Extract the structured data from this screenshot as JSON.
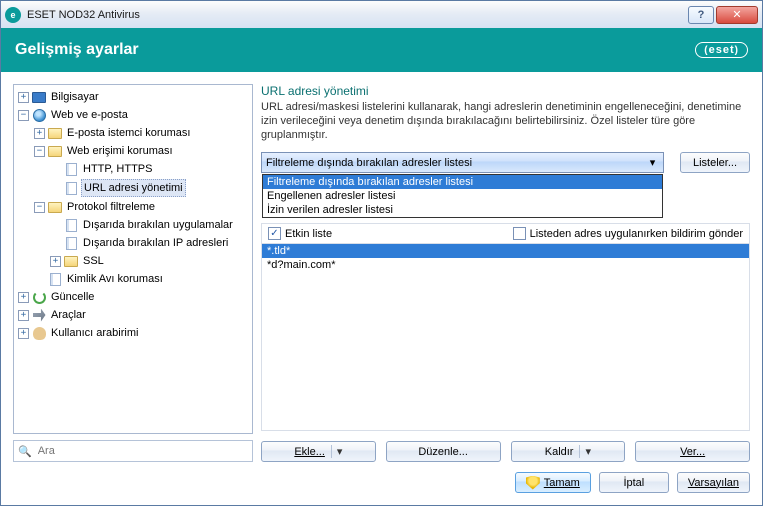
{
  "window": {
    "title": "ESET NOD32 Antivirus"
  },
  "header": {
    "title": "Gelişmiş ayarlar",
    "logo": "eset"
  },
  "tree": {
    "items": [
      {
        "label": "Bilgisayar",
        "icon": "monitor",
        "expand": "+"
      },
      {
        "label": "Web ve e-posta",
        "icon": "globe",
        "expand": "−",
        "children": [
          {
            "label": "E-posta istemci koruması",
            "icon": "folder",
            "expand": "+"
          },
          {
            "label": "Web erişimi koruması",
            "icon": "folder",
            "expand": "−",
            "children": [
              {
                "label": "HTTP, HTTPS",
                "icon": "page"
              },
              {
                "label": "URL adresi yönetimi",
                "icon": "page",
                "selected": true
              }
            ]
          },
          {
            "label": "Protokol filtreleme",
            "icon": "folder",
            "expand": "−",
            "children": [
              {
                "label": "Dışarıda bırakılan uygulamalar",
                "icon": "page"
              },
              {
                "label": "Dışarıda bırakılan IP adresleri",
                "icon": "page"
              },
              {
                "label": "SSL",
                "icon": "folder",
                "expand": "+"
              }
            ]
          },
          {
            "label": "Kimlik Avı koruması",
            "icon": "page"
          }
        ]
      },
      {
        "label": "Güncelle",
        "icon": "refresh",
        "expand": "+"
      },
      {
        "label": "Araçlar",
        "icon": "tools",
        "expand": "+"
      },
      {
        "label": "Kullanıcı arabirimi",
        "icon": "user",
        "expand": "+"
      }
    ]
  },
  "search": {
    "placeholder": "Ara"
  },
  "main": {
    "section_title": "URL adresi yönetimi",
    "section_desc": "URL adresi/maskesi listelerini kullanarak, hangi adreslerin denetiminin engelleneceğini, denetimine izin verileceğini veya denetim dışında bırakılacağını belirtebilirsiniz. Özel listeler türe göre gruplanmıştır.",
    "combo_value": "Filtreleme dışında bırakılan adresler listesi",
    "combo_options": [
      "Filtreleme dışında bırakılan adresler listesi",
      "Engellenen adresler listesi",
      "İzin verilen adresler listesi"
    ],
    "lists_button": "Listeler...",
    "active_list_checked": true,
    "active_list_label": "Etkin liste",
    "notify_checked": false,
    "notify_label": "Listeden adres uygulanırken bildirim gönder",
    "entries": [
      "*.tld*",
      "*d?main.com*"
    ],
    "buttons": {
      "add": "Ekle...",
      "edit": "Düzenle...",
      "remove": "Kaldır",
      "export": "Ver..."
    }
  },
  "footer": {
    "ok": "Tamam",
    "cancel": "İptal",
    "default": "Varsayılan"
  }
}
